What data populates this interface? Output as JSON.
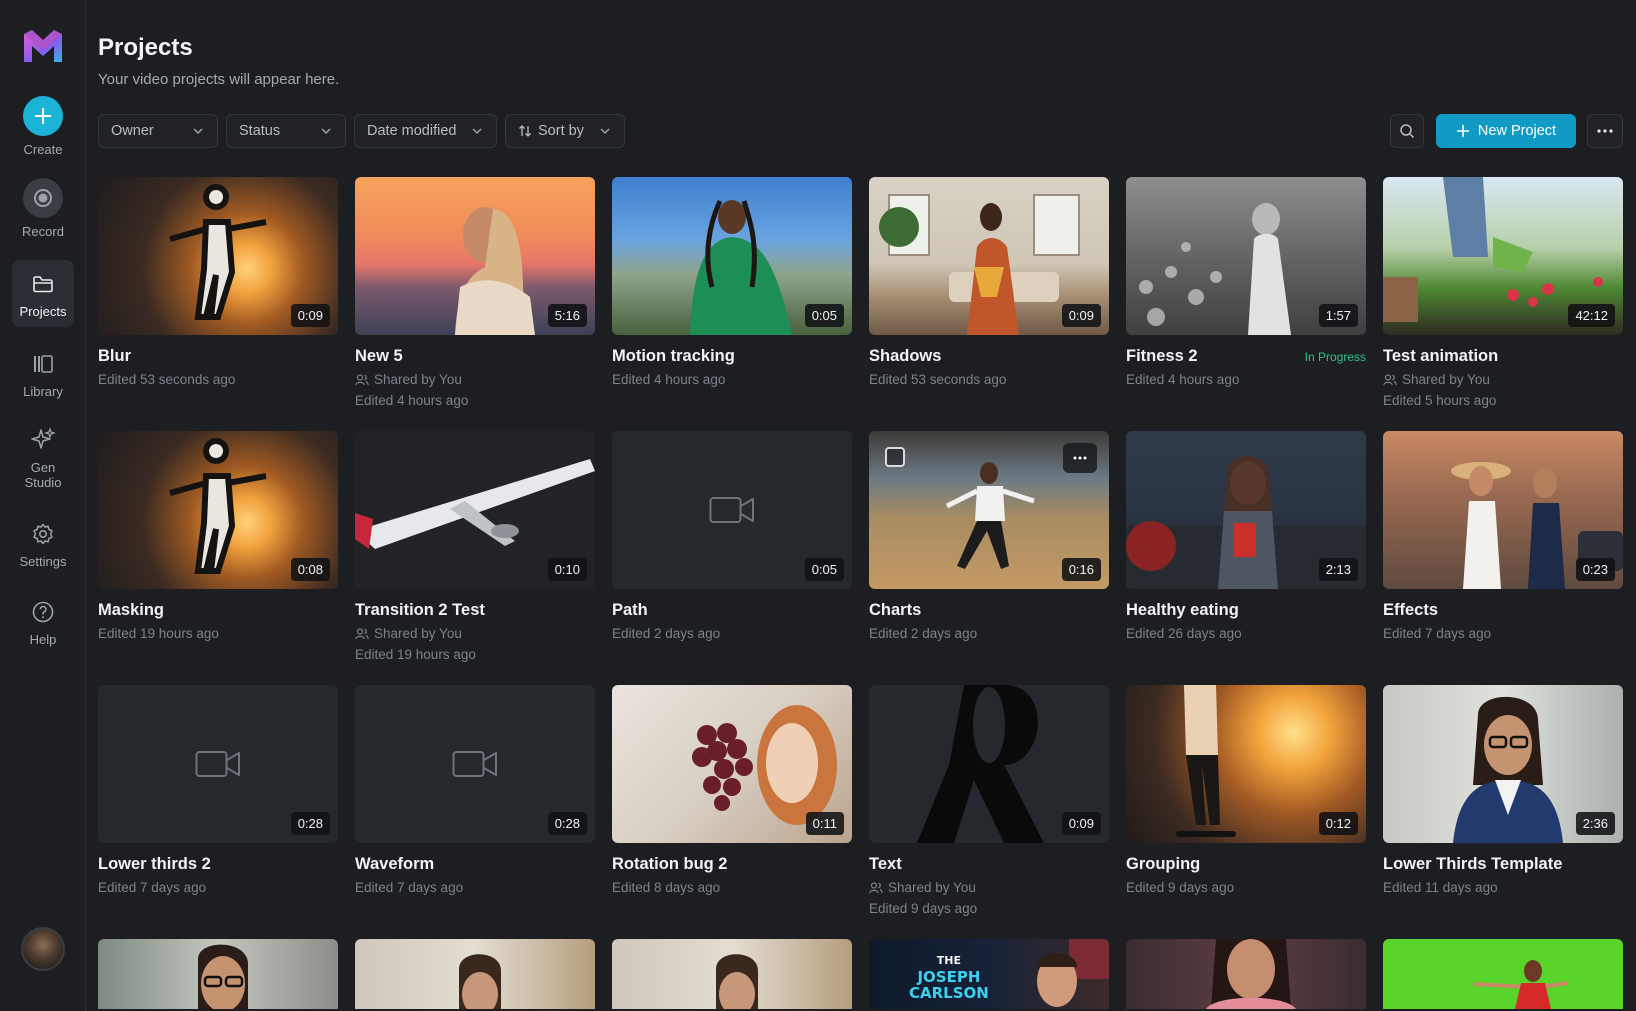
{
  "sidebar": {
    "items": [
      {
        "label": "Create",
        "icon": "plus-icon"
      },
      {
        "label": "Record",
        "icon": "record-icon"
      },
      {
        "label": "Projects",
        "icon": "folder-icon",
        "active": true
      },
      {
        "label": "Library",
        "icon": "library-icon"
      },
      {
        "label": "Gen Studio",
        "icon": "sparkles-icon"
      },
      {
        "label": "Settings",
        "icon": "gear-icon"
      },
      {
        "label": "Help",
        "icon": "help-icon"
      }
    ]
  },
  "header": {
    "title": "Projects",
    "subtitle": "Your video projects will appear here."
  },
  "filters": {
    "owner": "Owner",
    "status": "Status",
    "date": "Date modified",
    "sort": "Sort by"
  },
  "toolbar": {
    "new_project": "New Project"
  },
  "colors": {
    "accent": "#119bc4",
    "create": "#1cb3d6",
    "in_progress": "#2fc486"
  },
  "projects": [
    {
      "title": "Blur",
      "duration": "0:09",
      "edited": "Edited 53 seconds ago"
    },
    {
      "title": "New 5",
      "duration": "5:16",
      "shared": "Shared by You",
      "edited": "Edited 4 hours ago"
    },
    {
      "title": "Motion tracking",
      "duration": "0:05",
      "edited": "Edited 4 hours ago"
    },
    {
      "title": "Shadows",
      "duration": "0:09",
      "edited": "Edited 53 seconds ago"
    },
    {
      "title": "Fitness 2",
      "duration": "1:57",
      "badge": "In Progress",
      "edited": "Edited 4 hours ago"
    },
    {
      "title": "Test animation",
      "duration": "42:12",
      "shared": "Shared by You",
      "edited": "Edited 5 hours ago"
    },
    {
      "title": "Masking",
      "duration": "0:08",
      "edited": "Edited 19 hours ago"
    },
    {
      "title": "Transition 2 Test",
      "duration": "0:10",
      "shared": "Shared by You",
      "edited": "Edited 19 hours ago"
    },
    {
      "title": "Path",
      "duration": "0:05",
      "edited": "Edited 2 days ago"
    },
    {
      "title": "Charts",
      "duration": "0:16",
      "edited": "Edited 2 days ago"
    },
    {
      "title": "Healthy eating",
      "duration": "2:13",
      "edited": "Edited 26 days ago"
    },
    {
      "title": "Effects",
      "duration": "0:23",
      "edited": "Edited 7 days ago"
    },
    {
      "title": "Lower thirds 2",
      "duration": "0:28",
      "edited": "Edited 7 days ago"
    },
    {
      "title": "Waveform",
      "duration": "0:28",
      "edited": "Edited 7 days ago"
    },
    {
      "title": "Rotation bug 2",
      "duration": "0:11",
      "edited": "Edited 8 days ago"
    },
    {
      "title": "Text",
      "duration": "0:09",
      "shared": "Shared by You",
      "edited": "Edited 9 days ago"
    },
    {
      "title": "Grouping",
      "duration": "0:12",
      "edited": "Edited 9 days ago"
    },
    {
      "title": "Lower Thirds Template",
      "duration": "2:36",
      "edited": "Edited 11 days ago"
    }
  ],
  "partial_row": {
    "overlay_text_line1": "THE",
    "overlay_text_line2": "JOSEPH",
    "overlay_text_line3": "CARLSON"
  }
}
